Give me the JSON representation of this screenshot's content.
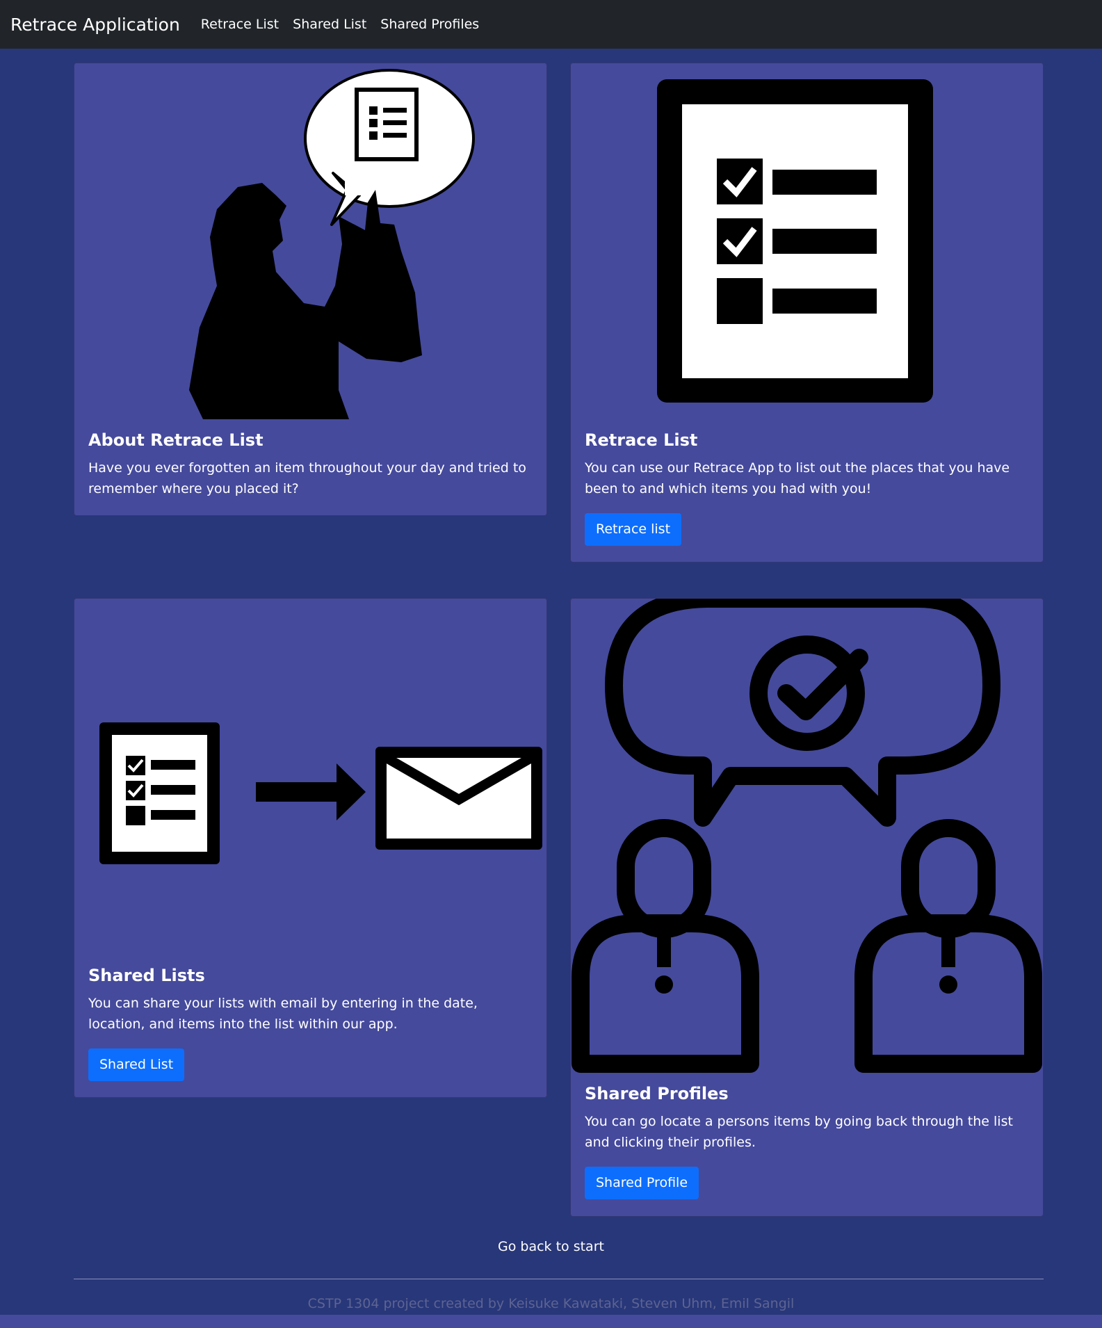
{
  "navbar": {
    "brand": "Retrace Application",
    "links": [
      "Retrace List",
      "Shared List",
      "Shared Profiles"
    ]
  },
  "cards": [
    {
      "title": "About Retrace List",
      "text": "Have you ever forgotten an item throughout your day and tried to remember where you placed it?",
      "image": "person-thinking-checklist-icon"
    },
    {
      "title": "Retrace List",
      "text": "You can use our Retrace App to list out the places that you have been to and which items you had with you!",
      "button": "Retrace list",
      "image": "checklist-clipboard-icon"
    },
    {
      "title": "Shared Lists",
      "text": "You can share your lists with email by entering in the date, location, and items into the list within our app.",
      "button": "Shared List",
      "image": "checklist-to-email-icon"
    },
    {
      "title": "Shared Profiles",
      "text": "You can go locate a persons items by going back through the list and clicking their profiles.",
      "button": "Shared Profile",
      "image": "two-people-chat-icon"
    }
  ],
  "back_link": "Go back to start",
  "footer": "CSTP 1304 project created by Keisuke Kawataki, Steven Uhm, Emil Sangil",
  "colors": {
    "background": "#283779",
    "card": "#454a9c",
    "navbar": "#212529",
    "button": "#0d6efd"
  }
}
